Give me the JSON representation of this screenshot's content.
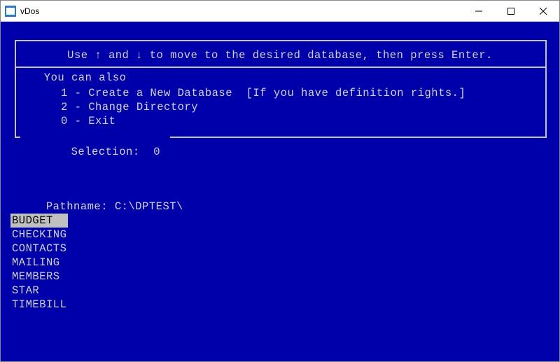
{
  "window": {
    "title": "vDos"
  },
  "instruction": "Use ↑ and ↓ to move to the desired database, then press Enter.",
  "box_label_you_can_also": " You can also ",
  "options": {
    "opt1": "1 - Create a New Database  [If you have definition rights.]",
    "opt2": "2 - Change Directory",
    "opt0": "0 - Exit"
  },
  "selection_label": " Selection:  ",
  "selection_value": "0",
  "pathname_label": "Pathname: ",
  "pathname_value": "C:\\DPTEST\\",
  "databases": [
    "BUDGET  ",
    "CHECKING",
    "CONTACTS",
    "MAILING",
    "MEMBERS",
    "STAR",
    "TIMEBILL"
  ],
  "selected_index": 0
}
